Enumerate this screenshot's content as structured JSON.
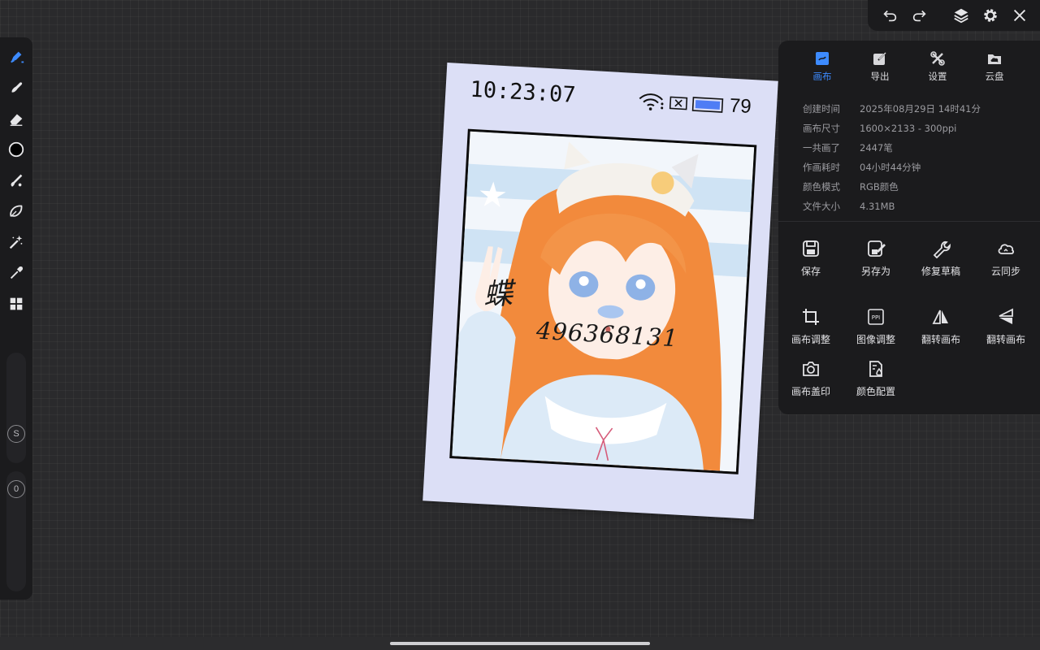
{
  "left_toolbar": {
    "tools": [
      {
        "icon": "brush-pen-icon",
        "active": true
      },
      {
        "icon": "smudge-icon"
      },
      {
        "icon": "eraser-icon"
      },
      {
        "icon": "color-circle-icon",
        "color": "#000000"
      },
      {
        "icon": "fill-brush-icon"
      },
      {
        "icon": "lasso-icon"
      },
      {
        "icon": "magic-wand-icon"
      },
      {
        "icon": "eyedropper-icon"
      },
      {
        "icon": "grid-menu-icon"
      }
    ],
    "size_slider_label": "S",
    "opacity_slider_label": "0"
  },
  "top_bar": {
    "buttons": [
      "undo-icon",
      "redo-icon",
      "layers-icon",
      "settings-gear-icon",
      "close-icon"
    ]
  },
  "canvas_card": {
    "time": "10:23:07",
    "battery_pct": "79",
    "handwritten_name": "蝶",
    "handwritten_number": "496368131"
  },
  "panel": {
    "tabs": [
      {
        "label": "画布",
        "icon": "canvas-icon",
        "active": true
      },
      {
        "label": "导出",
        "icon": "export-icon"
      },
      {
        "label": "设置",
        "icon": "tools-icon"
      },
      {
        "label": "云盘",
        "icon": "cloud-folder-icon"
      }
    ],
    "info": [
      {
        "key": "创建时间",
        "value": "2025年08月29日 14时41分"
      },
      {
        "key": "画布尺寸",
        "value": "1600×2133 - 300ppi"
      },
      {
        "key": "一共画了",
        "value": "2447笔"
      },
      {
        "key": "作画耗时",
        "value": "04小时44分钟"
      },
      {
        "key": "颜色模式",
        "value": "RGB颜色"
      },
      {
        "key": "文件大小",
        "value": "4.31MB"
      }
    ],
    "actions": [
      {
        "label": "保存",
        "icon": "save-icon"
      },
      {
        "label": "另存为",
        "icon": "save-as-icon"
      },
      {
        "label": "修复草稿",
        "icon": "repair-wrench-icon"
      },
      {
        "label": "云同步",
        "icon": "cloud-sync-icon"
      },
      {
        "label": "画布调整",
        "icon": "crop-icon"
      },
      {
        "label": "图像调整",
        "icon": "ppi-icon",
        "icon_text": "PPI"
      },
      {
        "label": "翻转画布",
        "icon": "flip-horizontal-icon"
      },
      {
        "label": "翻转画布",
        "icon": "flip-vertical-icon"
      },
      {
        "label": "画布盖印",
        "icon": "camera-stamp-icon"
      },
      {
        "label": "颜色配置",
        "icon": "color-profile-icon"
      }
    ]
  },
  "colors": {
    "accent": "#3d8bff",
    "panel_bg": "#1b1b1d",
    "workspace_bg": "#2a2a2c",
    "card_bg": "#dcdff6",
    "hair": "#f28a3c",
    "battery_fill": "#4f7df5"
  }
}
